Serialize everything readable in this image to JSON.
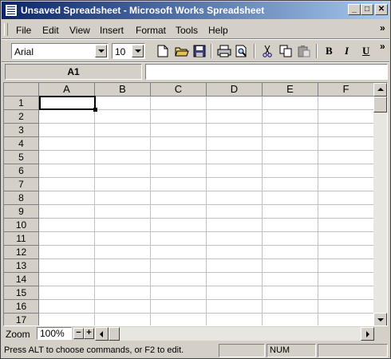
{
  "window": {
    "title": "Unsaved Spreadsheet - Microsoft Works Spreadsheet"
  },
  "title_buttons": {
    "minimize": "_",
    "maximize": "□",
    "close": "✕"
  },
  "menu": [
    "File",
    "Edit",
    "View",
    "Insert",
    "Format",
    "Tools",
    "Help"
  ],
  "menu_more": "»",
  "toolbar": {
    "font": "Arial",
    "size": "10",
    "bold": "B",
    "italic": "I",
    "underline": "U",
    "more": "»"
  },
  "entry": {
    "cell_ref": "A1",
    "formula": ""
  },
  "columns": [
    "A",
    "B",
    "C",
    "D",
    "E",
    "F"
  ],
  "rows": [
    "1",
    "2",
    "3",
    "4",
    "5",
    "6",
    "7",
    "8",
    "9",
    "10",
    "11",
    "12",
    "13",
    "14",
    "15",
    "16",
    "17"
  ],
  "zoom": {
    "label": "Zoom",
    "value": "100%",
    "minus": "−",
    "plus": "+"
  },
  "status": {
    "message": "Press ALT to choose commands, or F2 to edit.",
    "num": "NUM"
  }
}
